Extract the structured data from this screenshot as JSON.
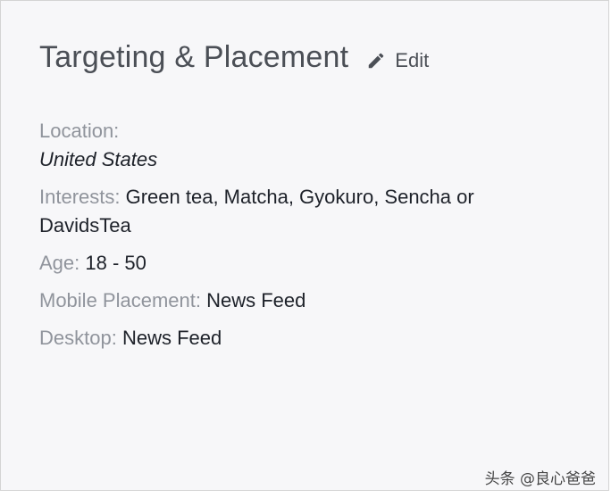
{
  "header": {
    "title": "Targeting & Placement",
    "edit_label": "Edit",
    "edit_icon": "pencil-icon"
  },
  "details": {
    "location_label": "Location:",
    "location_value": "United States",
    "interests_label": "Interests:",
    "interests_value": "Green tea, Matcha, Gyokuro, Sencha or DavidsTea",
    "age_label": "Age:",
    "age_value": "18 - 50",
    "mobile_label": "Mobile Placement:",
    "mobile_value": "News Feed",
    "desktop_label": "Desktop:",
    "desktop_value": "News Feed"
  },
  "watermark": "头条 @良心爸爸",
  "colors": {
    "title": "#4b4f56",
    "label": "#90949c",
    "value": "#1d2129",
    "panel_bg": "#f7f7f9",
    "border": "#d4d4d4"
  }
}
